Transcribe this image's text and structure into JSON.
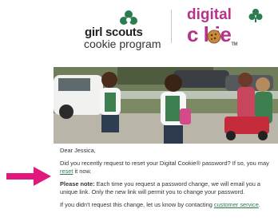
{
  "brand": {
    "gs_line1": "girl scouts",
    "gs_line2": "cookie program",
    "dc_line1": "digital",
    "dc_line2": "c  kie",
    "dc_tm": "TM"
  },
  "colors": {
    "brand_magenta": "#b5338a",
    "gs_green": "#2a7d4f",
    "arrow_pink": "#e0177d"
  },
  "email": {
    "greeting": "Dear Jessica,",
    "p1_before": "Did you recently request to reset your Digital Cookie® password? If so, you may ",
    "p1_link": "reset",
    "p1_after": " it now.",
    "p2_bold": "Please note:",
    "p2_rest": " Each time you request a password change, we will email you a unique link. Only the new link will permit you to change your password.",
    "p3_before": "If you didn't request this change, let us know by contacting ",
    "p3_link": "customer service",
    "p3_after": "."
  },
  "icons": {
    "trefoil": "trefoil-icon",
    "arrow": "arrow-right-icon"
  }
}
